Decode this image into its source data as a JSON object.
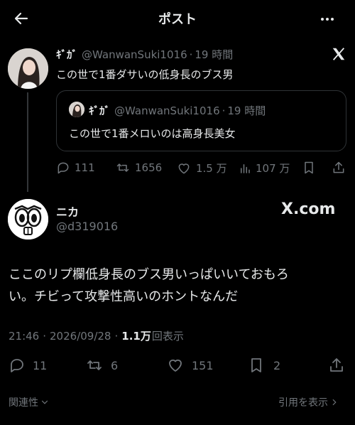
{
  "header": {
    "title": "ポスト"
  },
  "original_post": {
    "name": "ｷﾞｶﾞ",
    "handle": "@WanwanSuki1016",
    "sep": "·",
    "time": "19 時間",
    "text": "この世で1番ダサいの低身長のブス男",
    "quoted": {
      "name": "ｷﾞｶﾞ",
      "handle": "@WanwanSuki1016",
      "sep": "·",
      "time": "19 時間",
      "text": "この世で1番メロいのは高身長美女"
    },
    "stats": {
      "replies": "111",
      "reposts": "1656",
      "likes": "1.5 万",
      "views": "107 万"
    }
  },
  "reply_post": {
    "name": "ニカ",
    "handle": "@d319016",
    "watermark": "X.com",
    "text_line1": "ここのリプ欄低身長のブス男いっぱいいておもろ",
    "text_line2": "い。チビって攻撃性高いのホントなんだ",
    "meta": {
      "time": "21:46",
      "sep1": "·",
      "date": "2026/09/28",
      "sep2": "·",
      "views_count": "1.1万",
      "views_label": "回表示"
    },
    "stats": {
      "replies": "11",
      "reposts": "6",
      "likes": "151",
      "bookmarks": "2"
    }
  },
  "footer": {
    "related": "関連性",
    "quotes": "引用を表示"
  },
  "colors": {
    "background": "#000000",
    "text": "#e7e9ea",
    "muted": "#71767b",
    "border": "#2f3336"
  }
}
